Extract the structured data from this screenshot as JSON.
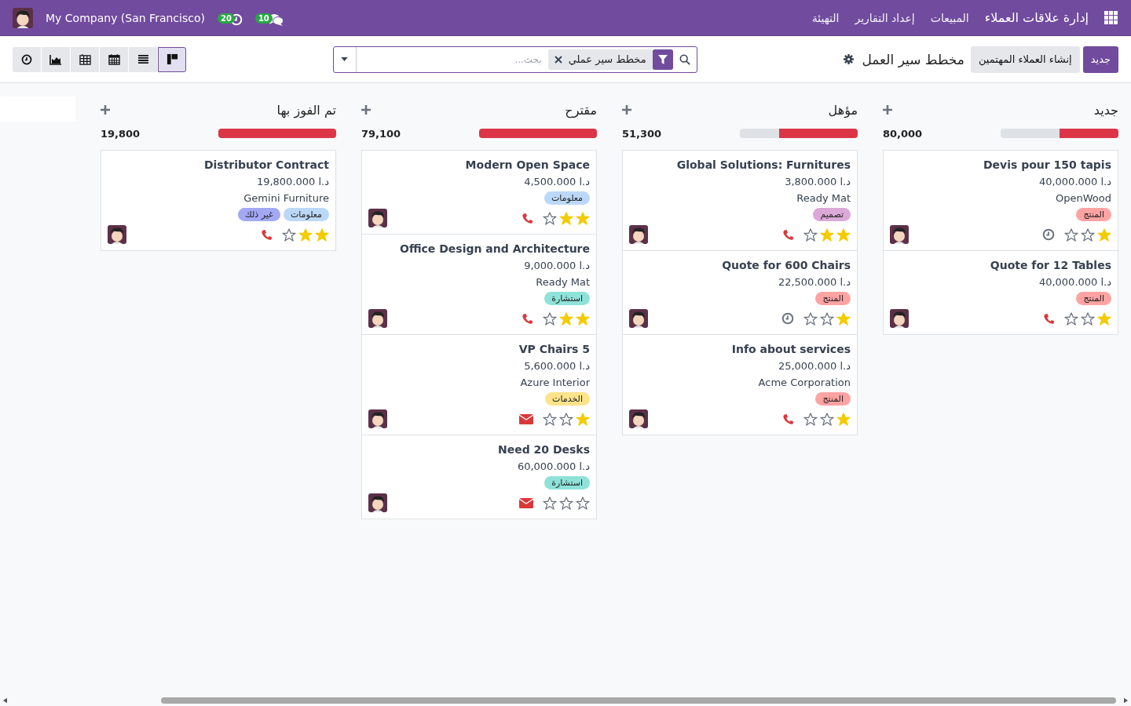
{
  "navbar": {
    "app_title": "إدارة علاقات العملاء",
    "menus": [
      "المبيعات",
      "إعداد التقارير",
      "التهيئة"
    ],
    "company": "My Company (San Francisco)",
    "activity_count": "20",
    "message_count": "10"
  },
  "control_panel": {
    "new_button": "جديد",
    "generate_button": "إنشاء العملاء المهتمين",
    "title": "مخطط سير العمل",
    "search": {
      "facet": "مخطط سير عملي",
      "placeholder": "بحث..."
    },
    "views": [
      {
        "kind": "activity",
        "selected": false
      },
      {
        "kind": "graph",
        "selected": false
      },
      {
        "kind": "pivot",
        "selected": false
      },
      {
        "kind": "calendar",
        "selected": false
      },
      {
        "kind": "list",
        "selected": false
      },
      {
        "kind": "kanban",
        "selected": true
      }
    ]
  },
  "columns": [
    {
      "title": "جديد",
      "total": "80,000",
      "level": 0.5,
      "cards": [
        {
          "title": "Devis pour 150 tapis",
          "amount": "د.ا 40,000.000",
          "customer": "OpenWood",
          "tags": [
            {
              "label": "المنتج",
              "color": "#ffa3a3"
            }
          ],
          "stars": 1,
          "activity": {
            "kind": "clock"
          }
        },
        {
          "title": "Quote for 12 Tables",
          "amount": "د.ا 40,000.000",
          "tags": [
            {
              "label": "المنتج",
              "color": "#ffa3a3"
            }
          ],
          "stars": 1,
          "activity": {
            "kind": "phone"
          }
        }
      ]
    },
    {
      "title": "مؤهل",
      "total": "51,300",
      "level": 0.67,
      "cards": [
        {
          "title": "Global Solutions: Furnitures",
          "amount": "د.ا 3,800.000",
          "customer": "Ready Mat",
          "tags": [
            {
              "label": "تصميم",
              "color": "#dba8d8"
            }
          ],
          "stars": 2,
          "activity": {
            "kind": "phone"
          }
        },
        {
          "title": "Quote for 600 Chairs",
          "amount": "د.ا 22,500.000",
          "tags": [
            {
              "label": "المنتج",
              "color": "#ffa3a3"
            }
          ],
          "stars": 1,
          "activity": {
            "kind": "clock"
          }
        },
        {
          "title": "Info about services",
          "amount": "د.ا 25,000.000",
          "customer": "Acme Corporation",
          "tags": [
            {
              "label": "المنتج",
              "color": "#ffa3a3"
            }
          ],
          "stars": 1,
          "activity": {
            "kind": "phone"
          }
        }
      ]
    },
    {
      "title": "مقترح",
      "total": "79,100",
      "level": 1,
      "cards": [
        {
          "title": "Modern Open Space",
          "amount": "د.ا 4,500.000",
          "tags": [
            {
              "label": "معلومات",
              "color": "#bcd8f8"
            }
          ],
          "stars": 2,
          "activity": {
            "kind": "phone"
          }
        },
        {
          "title": "Office Design and Architecture",
          "amount": "د.ا 9,000.000",
          "customer": "Ready Mat",
          "tags": [
            {
              "label": "استشارة",
              "color": "#8ee2d8"
            }
          ],
          "stars": 2,
          "activity": {
            "kind": "phone"
          }
        },
        {
          "title": "VP Chairs 5",
          "amount": "د.ا 5,600.000",
          "customer": "Azure Interior",
          "tags": [
            {
              "label": "الخدمات",
              "color": "#fde38a"
            }
          ],
          "stars": 1,
          "activity": {
            "kind": "mail"
          }
        },
        {
          "title": "Need 20 Desks",
          "amount": "د.ا 60,000.000",
          "tags": [
            {
              "label": "استشارة",
              "color": "#8ee2d8"
            }
          ],
          "stars": 0,
          "activity": {
            "kind": "mail"
          }
        }
      ]
    },
    {
      "title": "تم الفوز بها",
      "total": "19,800",
      "level": 1,
      "cards": [
        {
          "title": "Distributor Contract",
          "amount": "د.ا 19,800.000",
          "customer": "Gemini Furniture",
          "tags": [
            {
              "label": "معلومات",
              "color": "#bcd8f8"
            },
            {
              "label": "غير ذلك",
              "color": "#a3a8f5"
            }
          ],
          "stars": 2,
          "activity": {
            "kind": "phone"
          }
        }
      ]
    }
  ]
}
